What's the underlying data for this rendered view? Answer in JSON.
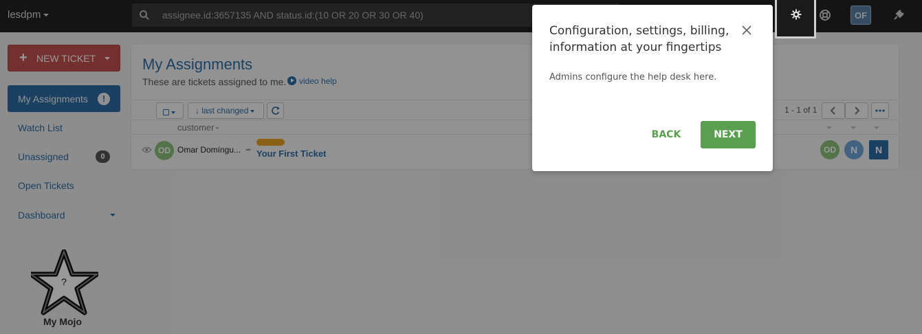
{
  "topbar": {
    "brand": "lesdpm",
    "search_value": "assignee.id:3657135 AND status.id:(10 OR 20 OR 30 OR 40)",
    "user_initials": "OF"
  },
  "sidebar": {
    "new_ticket_label": "NEW TICKET",
    "items": [
      {
        "label": "My Assignments"
      },
      {
        "label": "Watch List"
      },
      {
        "label": "Unassigned",
        "count": "0"
      },
      {
        "label": "Open Tickets"
      },
      {
        "label": "Dashboard"
      }
    ],
    "mojo_label": "My Mojo"
  },
  "main": {
    "title": "My Assignments",
    "subtitle": "These are tickets assigned to me.",
    "video_help": "video help",
    "sort_label": "↓ last changed",
    "pager": "1 - 1 of 1",
    "column_customer": "customer",
    "rows": [
      {
        "customer_initials": "OD",
        "customer_name": "Omar Domíngu...",
        "ticket_title": "Your First Ticket",
        "tag_color": "#e8a020",
        "assignee_avatars": [
          "OD",
          "N",
          "N"
        ]
      }
    ]
  },
  "modal": {
    "title": "Configuration, settings, billing, information at your fingertips",
    "body": "Admins configure the help desk here.",
    "back_label": "BACK",
    "next_label": "NEXT"
  },
  "colors": {
    "accent": "#2e6da4",
    "danger": "#c0504e",
    "success": "#5a9e4f"
  }
}
